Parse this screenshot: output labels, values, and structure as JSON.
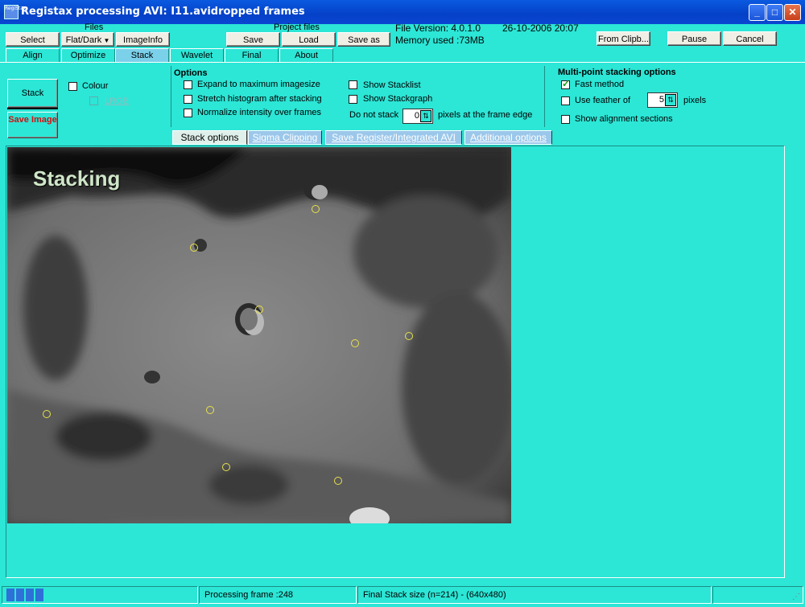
{
  "window": {
    "title": "Registax processing AVI: I11.avidropped frames",
    "icon_text": "RegiStax",
    "controls": {
      "minimize": "_",
      "maximize": "□",
      "close": "✕"
    }
  },
  "toolbar": {
    "files_label": "Files",
    "project_files_label": "Project files",
    "select": "Select",
    "flat_dark": "Flat/Dark",
    "imageinfo": "ImageInfo",
    "save": "Save",
    "load": "Load",
    "save_as": "Save as",
    "file_version": "File Version: 4.0.1.0",
    "datetime": "26-10-2006 20:07",
    "memory_used": "Memory used :73MB",
    "from_clipboard": "From Clipb...",
    "pause": "Pause",
    "cancel": "Cancel"
  },
  "tabs": [
    {
      "label": "Align"
    },
    {
      "label": "Optimize"
    },
    {
      "label": "Stack",
      "active": true
    },
    {
      "label": "Wavelet"
    },
    {
      "label": "Final"
    },
    {
      "label": "About"
    }
  ],
  "left_panel": {
    "stack": "Stack",
    "save_image": "Save Image",
    "colour": "Colour",
    "lrgb": "LRGB"
  },
  "options": {
    "heading": "Options",
    "expand": "Expand to maximum imagesize",
    "stretch": "Stretch histogram after stacking",
    "normalize": "Normalize intensity over frames",
    "show_stacklist": "Show Stacklist",
    "show_stackgraph": "Show Stackgraph",
    "do_not_stack": "Do not stack",
    "do_not_stack_value": "0",
    "pixels_edge": "pixels at the frame edge"
  },
  "multipoint": {
    "heading": "Multi-point stacking options",
    "fast_method": "Fast method",
    "fast_method_checked": true,
    "use_feather": "Use feather of",
    "feather_value": "5",
    "pixels": "pixels",
    "show_alignment": "Show alignment sections"
  },
  "subtabs": [
    {
      "label": "Stack  options",
      "active": true
    },
    {
      "label": "Sigma Clipping"
    },
    {
      "label": "Save Register/Integrated AVI"
    },
    {
      "label": "Additional options"
    }
  ],
  "image": {
    "overlay_text": "Stacking",
    "alignment_points": 10
  },
  "status": {
    "progress_percent": 20,
    "processing_frame": "Processing frame :248",
    "final_stack": "Final Stack size (n=214) - (640x480)"
  },
  "colors": {
    "background": "#2ce6d6",
    "titlebar": "#0a5ae0",
    "save_image_text": "#d01010",
    "marker": "#e8e24a",
    "progress": "#2f6fd8"
  }
}
